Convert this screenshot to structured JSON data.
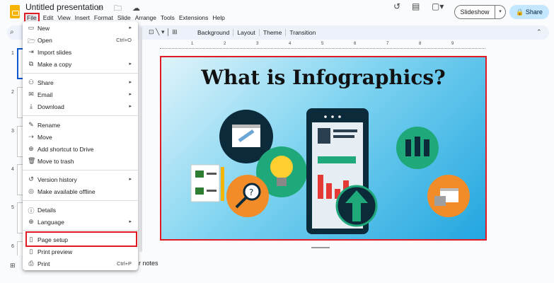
{
  "app": {
    "title": "Untitled presentation",
    "title_icons": "☆ 🗀 ☁"
  },
  "menubar": [
    "File",
    "Edit",
    "View",
    "Insert",
    "Format",
    "Slide",
    "Arrange",
    "Tools",
    "Extensions",
    "Help"
  ],
  "top_right": {
    "history_icon": "history-icon",
    "comments_icon": "comments-icon",
    "meet_icon": "camera-icon",
    "slideshow_label": "Slideshow",
    "share_label": "Share"
  },
  "toolbar": {
    "labels": [
      "Background",
      "Layout",
      "Theme",
      "Transition"
    ]
  },
  "ruler": [
    "1",
    "2",
    "3",
    "4",
    "5",
    "6",
    "7",
    "8",
    "9"
  ],
  "filmstrip": [
    "1",
    "2",
    "3",
    "4",
    "5",
    "6"
  ],
  "slide": {
    "title": "What is Infographics?"
  },
  "notes": {
    "label": "r notes"
  },
  "file_menu": {
    "items": [
      {
        "icon": "new-icon",
        "glyph": "▭",
        "label": "New",
        "shortcut": "",
        "arrow": true
      },
      {
        "icon": "open-icon",
        "glyph": "🗁",
        "label": "Open",
        "shortcut": "Ctrl+O",
        "arrow": false
      },
      {
        "icon": "import-icon",
        "glyph": "⇥",
        "label": "Import slides",
        "shortcut": "",
        "arrow": false
      },
      {
        "icon": "copy-icon",
        "glyph": "⧉",
        "label": "Make a copy",
        "shortcut": "",
        "arrow": true
      },
      {
        "icon": "share-icon",
        "glyph": "⚇",
        "label": "Share",
        "shortcut": "",
        "arrow": true
      },
      {
        "icon": "email-icon",
        "glyph": "✉",
        "label": "Email",
        "shortcut": "",
        "arrow": true
      },
      {
        "icon": "download-icon",
        "glyph": "⤓",
        "label": "Download",
        "shortcut": "",
        "arrow": true
      },
      {
        "icon": "rename-icon",
        "glyph": "✎",
        "label": "Rename",
        "shortcut": "",
        "arrow": false
      },
      {
        "icon": "move-icon",
        "glyph": "⇢",
        "label": "Move",
        "shortcut": "",
        "arrow": false
      },
      {
        "icon": "shortcut-icon",
        "glyph": "⊕",
        "label": "Add shortcut to Drive",
        "shortcut": "",
        "arrow": false
      },
      {
        "icon": "trash-icon",
        "glyph": "🗑",
        "label": "Move to trash",
        "shortcut": "",
        "arrow": false
      },
      {
        "icon": "history-icon",
        "glyph": "↺",
        "label": "Version history",
        "shortcut": "",
        "arrow": true
      },
      {
        "icon": "offline-icon",
        "glyph": "◎",
        "label": "Make available offline",
        "shortcut": "",
        "arrow": false
      },
      {
        "icon": "details-icon",
        "glyph": "ⓘ",
        "label": "Details",
        "shortcut": "",
        "arrow": false
      },
      {
        "icon": "language-icon",
        "glyph": "⊕",
        "label": "Language",
        "shortcut": "",
        "arrow": true
      },
      {
        "icon": "page-setup-icon",
        "glyph": "▯",
        "label": "Page setup",
        "shortcut": "",
        "arrow": false
      },
      {
        "icon": "print-preview-icon",
        "glyph": "▯",
        "label": "Print preview",
        "shortcut": "",
        "arrow": false
      },
      {
        "icon": "print-icon",
        "glyph": "⎙",
        "label": "Print",
        "shortcut": "Ctrl+P",
        "arrow": false
      }
    ]
  },
  "colors": {
    "accent": "#0b57d0",
    "highlight": "#e01b24",
    "share_bg": "#c2e7ff"
  }
}
